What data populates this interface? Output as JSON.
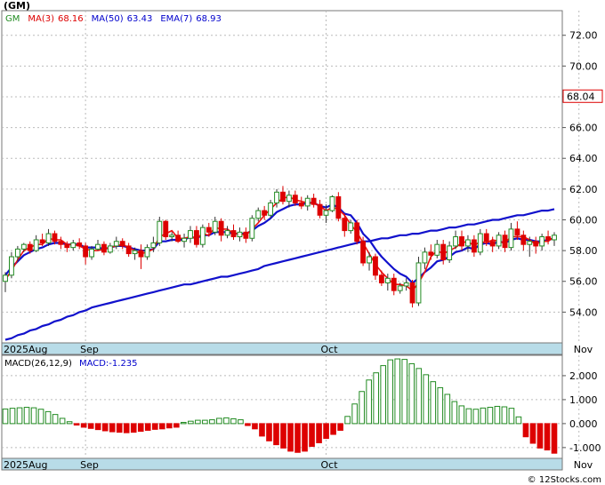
{
  "ticker": "(GM)",
  "legend": [
    {
      "label": "GM",
      "color": "#228B22"
    },
    {
      "label": "MA(3)",
      "value": "68.16",
      "color": "#dd0000"
    },
    {
      "label": "MA(50)",
      "value": "63.43",
      "color": "#0000cc"
    },
    {
      "label": "EMA(7)",
      "value": "68.93",
      "color": "#0000cc"
    }
  ],
  "last_price_label": "68.04",
  "macd_legend": {
    "label": "MACD(26,12,9)",
    "value_label": "MACD:-1.235"
  },
  "watermark": "© 12Stocks.com",
  "colors": {
    "up": "#228B22",
    "down": "#dd0000",
    "ma3": "#ee1111",
    "ma50": "#1111cc",
    "ema7": "#1111cc",
    "axis_band": "#b8dce8"
  },
  "chart_data": [
    {
      "type": "candlestick",
      "x_labels": [
        {
          "label": "2025Aug",
          "index": 0
        },
        {
          "label": "Sep",
          "index": 13
        },
        {
          "label": "Oct",
          "index": 52
        },
        {
          "label": "Nov",
          "index": 93
        }
      ],
      "ylim": [
        52.0,
        73.6
      ],
      "yticks": [
        "54.00",
        "56.00",
        "58.00",
        "60.00",
        "62.00",
        "64.00",
        "66.00",
        "68.00",
        "70.00",
        "72.00"
      ],
      "candles": [
        [
          56.0,
          56.6,
          55.3,
          56.4
        ],
        [
          56.4,
          57.9,
          56.2,
          57.6
        ],
        [
          57.6,
          58.3,
          57.3,
          58.1
        ],
        [
          58.1,
          58.5,
          57.9,
          58.4
        ],
        [
          58.4,
          58.6,
          57.8,
          58.0
        ],
        [
          58.0,
          59.0,
          57.9,
          58.7
        ],
        [
          58.7,
          59.1,
          58.3,
          58.5
        ],
        [
          58.5,
          59.4,
          58.3,
          59.1
        ],
        [
          59.1,
          59.3,
          58.4,
          58.6
        ],
        [
          58.6,
          58.9,
          58.1,
          58.4
        ],
        [
          58.4,
          58.6,
          57.9,
          58.2
        ],
        [
          58.2,
          58.7,
          58.0,
          58.5
        ],
        [
          58.5,
          58.8,
          58.1,
          58.3
        ],
        [
          58.3,
          58.5,
          57.1,
          57.6
        ],
        [
          57.6,
          58.3,
          57.4,
          58.1
        ],
        [
          58.1,
          58.7,
          58.0,
          58.4
        ],
        [
          58.4,
          58.6,
          57.7,
          57.9
        ],
        [
          57.9,
          58.5,
          57.8,
          58.3
        ],
        [
          58.3,
          58.9,
          58.1,
          58.6
        ],
        [
          58.6,
          58.8,
          58.1,
          58.3
        ],
        [
          58.3,
          58.5,
          57.6,
          57.8
        ],
        [
          57.8,
          58.2,
          57.4,
          58.0
        ],
        [
          58.0,
          58.4,
          56.8,
          57.6
        ],
        [
          57.6,
          58.4,
          57.4,
          58.2
        ],
        [
          58.2,
          58.9,
          57.9,
          58.5
        ],
        [
          58.5,
          60.2,
          58.3,
          59.9
        ],
        [
          59.9,
          60.0,
          58.7,
          58.9
        ],
        [
          58.9,
          59.2,
          58.6,
          59.0
        ],
        [
          59.0,
          59.3,
          58.5,
          58.6
        ],
        [
          58.6,
          59.1,
          58.2,
          58.8
        ],
        [
          58.8,
          59.6,
          58.5,
          59.3
        ],
        [
          59.3,
          59.6,
          58.2,
          58.4
        ],
        [
          58.4,
          59.7,
          58.2,
          59.5
        ],
        [
          59.5,
          59.8,
          58.9,
          59.2
        ],
        [
          59.2,
          60.2,
          59.0,
          59.9
        ],
        [
          59.9,
          60.1,
          58.6,
          59.0
        ],
        [
          59.0,
          59.6,
          58.8,
          59.3
        ],
        [
          59.3,
          59.7,
          58.7,
          58.9
        ],
        [
          58.9,
          59.5,
          58.6,
          59.2
        ],
        [
          59.2,
          59.5,
          58.5,
          58.8
        ],
        [
          58.8,
          60.3,
          58.6,
          60.1
        ],
        [
          60.1,
          60.8,
          59.9,
          60.6
        ],
        [
          60.6,
          60.9,
          60.0,
          60.3
        ],
        [
          60.3,
          61.3,
          60.1,
          61.1
        ],
        [
          61.1,
          62.0,
          60.8,
          61.8
        ],
        [
          61.8,
          62.2,
          61.0,
          61.2
        ],
        [
          61.2,
          61.9,
          60.8,
          61.6
        ],
        [
          61.6,
          61.9,
          60.9,
          61.1
        ],
        [
          61.1,
          61.5,
          60.7,
          60.9
        ],
        [
          60.9,
          61.6,
          60.6,
          61.4
        ],
        [
          61.4,
          61.7,
          60.8,
          61.0
        ],
        [
          61.0,
          61.3,
          60.1,
          60.3
        ],
        [
          60.3,
          61.0,
          59.8,
          60.6
        ],
        [
          60.6,
          61.6,
          60.5,
          61.5
        ],
        [
          61.5,
          61.8,
          59.9,
          60.1
        ],
        [
          60.1,
          60.4,
          58.9,
          59.3
        ],
        [
          59.3,
          60.0,
          59.1,
          59.8
        ],
        [
          59.8,
          60.0,
          58.4,
          58.6
        ],
        [
          58.6,
          58.9,
          57.0,
          57.2
        ],
        [
          57.2,
          57.9,
          56.7,
          57.6
        ],
        [
          57.6,
          57.8,
          56.1,
          56.4
        ],
        [
          56.4,
          56.7,
          55.7,
          55.9
        ],
        [
          55.9,
          56.5,
          55.4,
          56.2
        ],
        [
          56.2,
          56.5,
          55.1,
          55.4
        ],
        [
          55.4,
          55.9,
          55.2,
          55.7
        ],
        [
          55.7,
          56.2,
          55.4,
          55.9
        ],
        [
          55.9,
          56.1,
          54.3,
          54.6
        ],
        [
          54.6,
          57.6,
          54.4,
          57.2
        ],
        [
          57.2,
          58.2,
          56.8,
          57.9
        ],
        [
          57.9,
          58.4,
          57.4,
          57.7
        ],
        [
          57.7,
          58.7,
          57.5,
          58.4
        ],
        [
          58.4,
          58.7,
          57.1,
          57.4
        ],
        [
          57.4,
          58.6,
          57.2,
          58.3
        ],
        [
          58.3,
          59.3,
          58.1,
          58.9
        ],
        [
          58.9,
          59.3,
          58.0,
          58.3
        ],
        [
          58.3,
          59.0,
          57.9,
          58.7
        ],
        [
          58.7,
          59.0,
          57.6,
          57.9
        ],
        [
          57.9,
          59.4,
          57.7,
          59.1
        ],
        [
          59.1,
          59.4,
          58.3,
          58.6
        ],
        [
          58.6,
          58.9,
          57.9,
          58.3
        ],
        [
          58.3,
          59.2,
          58.1,
          59.0
        ],
        [
          59.0,
          59.3,
          57.9,
          58.2
        ],
        [
          58.2,
          59.8,
          58.0,
          59.4
        ],
        [
          59.4,
          59.9,
          58.7,
          59.0
        ],
        [
          59.0,
          59.3,
          58.0,
          58.4
        ],
        [
          58.4,
          58.9,
          57.6,
          58.6
        ],
        [
          58.6,
          58.9,
          57.8,
          58.3
        ],
        [
          58.3,
          59.1,
          58.0,
          58.9
        ],
        [
          58.9,
          59.3,
          58.4,
          58.7
        ],
        [
          58.7,
          59.2,
          58.3,
          59.0
        ]
      ],
      "ma3": [
        56.1,
        56.7,
        57.4,
        58.0,
        58.2,
        58.4,
        58.4,
        58.8,
        58.7,
        58.7,
        58.4,
        58.4,
        58.3,
        58.1,
        58.0,
        58.0,
        58.1,
        58.2,
        58.3,
        58.4,
        58.2,
        58.0,
        57.8,
        57.9,
        58.1,
        58.9,
        59.1,
        59.3,
        58.8,
        58.8,
        58.9,
        58.8,
        59.1,
        59.0,
        59.5,
        59.4,
        59.4,
        59.1,
        59.1,
        59.0,
        59.4,
        59.8,
        60.3,
        60.7,
        61.1,
        61.4,
        61.5,
        61.3,
        61.2,
        61.1,
        61.1,
        60.9,
        60.6,
        60.8,
        60.7,
        60.3,
        59.7,
        59.2,
        58.5,
        57.8,
        57.1,
        56.6,
        56.2,
        55.8,
        55.8,
        55.7,
        55.4,
        55.9,
        56.6,
        57.6,
        58.0,
        57.8,
        58.0,
        58.2,
        58.5,
        58.6,
        58.3,
        58.6,
        58.5,
        58.7,
        58.6,
        58.5,
        58.9,
        58.9,
        58.9,
        58.7,
        58.4,
        58.6,
        58.6,
        58.9
      ],
      "ma50": [
        52.2,
        52.3,
        52.5,
        52.6,
        52.8,
        52.9,
        53.1,
        53.2,
        53.4,
        53.5,
        53.7,
        53.8,
        54.0,
        54.1,
        54.3,
        54.4,
        54.5,
        54.6,
        54.7,
        54.8,
        54.9,
        55.0,
        55.1,
        55.2,
        55.3,
        55.4,
        55.5,
        55.6,
        55.7,
        55.8,
        55.8,
        55.9,
        56.0,
        56.1,
        56.2,
        56.3,
        56.3,
        56.4,
        56.5,
        56.6,
        56.7,
        56.8,
        57.0,
        57.1,
        57.2,
        57.3,
        57.4,
        57.5,
        57.6,
        57.7,
        57.8,
        57.9,
        58.0,
        58.1,
        58.2,
        58.3,
        58.4,
        58.5,
        58.6,
        58.6,
        58.7,
        58.8,
        58.8,
        58.9,
        59.0,
        59.0,
        59.1,
        59.1,
        59.2,
        59.3,
        59.3,
        59.4,
        59.5,
        59.5,
        59.6,
        59.7,
        59.7,
        59.8,
        59.9,
        60.0,
        60.0,
        60.1,
        60.2,
        60.3,
        60.3,
        60.4,
        60.5,
        60.6,
        60.6,
        60.7
      ],
      "ema7": [
        56.4,
        56.9,
        57.3,
        57.7,
        57.9,
        58.1,
        58.2,
        58.4,
        58.5,
        58.5,
        58.4,
        58.4,
        58.4,
        58.2,
        58.2,
        58.2,
        58.1,
        58.2,
        58.3,
        58.3,
        58.2,
        58.1,
        58.0,
        58.0,
        58.1,
        58.6,
        58.6,
        58.7,
        58.7,
        58.7,
        58.9,
        58.8,
        59.0,
        59.0,
        59.2,
        59.2,
        59.2,
        59.1,
        59.1,
        59.1,
        59.3,
        59.6,
        59.8,
        60.1,
        60.5,
        60.7,
        60.9,
        61.0,
        61.0,
        61.1,
        61.1,
        60.9,
        60.8,
        61.0,
        60.8,
        60.4,
        60.3,
        59.8,
        59.1,
        58.7,
        58.1,
        57.6,
        57.2,
        56.8,
        56.5,
        56.3,
        55.9,
        56.2,
        56.6,
        56.9,
        57.3,
        57.4,
        57.6,
        57.9,
        58.0,
        58.2,
        58.1,
        58.4,
        58.5,
        58.4,
        58.6,
        58.5,
        58.7,
        58.8,
        58.7,
        58.7,
        58.6,
        58.6,
        58.7,
        58.8
      ]
    },
    {
      "type": "bar",
      "title": "MACD(26,12,9)",
      "ylim": [
        -1.45,
        2.85
      ],
      "yticks": [
        "2.000",
        "1.000",
        "0.000",
        "-1.000"
      ],
      "values": [
        0.61,
        0.64,
        0.66,
        0.68,
        0.66,
        0.6,
        0.5,
        0.38,
        0.22,
        0.08,
        -0.06,
        -0.15,
        -0.2,
        -0.25,
        -0.3,
        -0.34,
        -0.36,
        -0.38,
        -0.36,
        -0.32,
        -0.28,
        -0.24,
        -0.22,
        -0.18,
        -0.15,
        0.05,
        0.1,
        0.14,
        0.14,
        0.16,
        0.22,
        0.24,
        0.2,
        0.16,
        -0.08,
        -0.22,
        -0.52,
        -0.72,
        -0.88,
        -1.02,
        -1.15,
        -1.2,
        -1.15,
        -0.95,
        -0.8,
        -0.62,
        -0.45,
        -0.28,
        0.3,
        0.82,
        1.34,
        1.82,
        2.12,
        2.42,
        2.66,
        2.7,
        2.68,
        2.5,
        2.3,
        2.04,
        1.75,
        1.5,
        1.22,
        0.92,
        0.74,
        0.62,
        0.6,
        0.65,
        0.68,
        0.72,
        0.7,
        0.64,
        0.28,
        -0.55,
        -0.82,
        -1.02,
        -1.1,
        -1.235
      ]
    }
  ]
}
